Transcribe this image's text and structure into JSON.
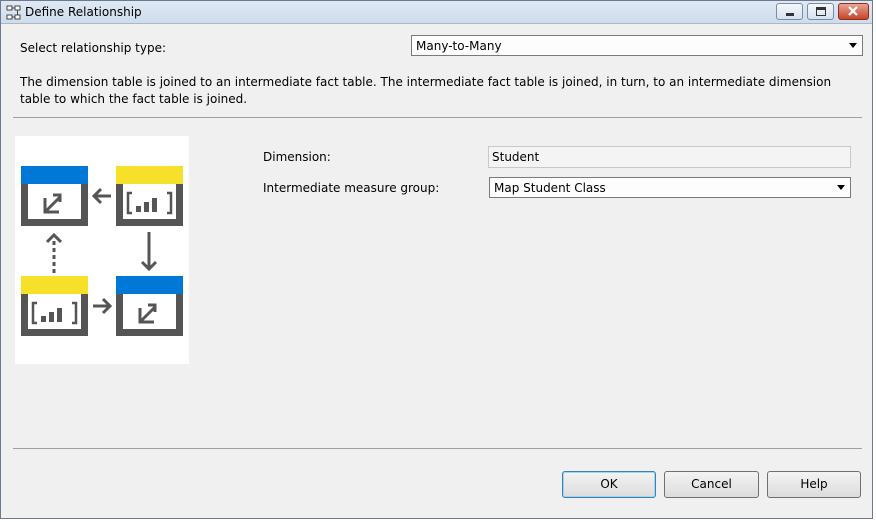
{
  "window": {
    "title": "Define Relationship"
  },
  "relationship": {
    "label": "Select relationship type:",
    "selected": "Many-to-Many",
    "description": "The dimension table is joined to an intermediate fact table. The intermediate fact table is joined, in turn, to an intermediate dimension table to which the fact table is joined."
  },
  "fields": {
    "dimension_label": "Dimension:",
    "dimension_value": "Student",
    "measure_group_label": "Intermediate measure group:",
    "measure_group_value": "Map Student Class"
  },
  "buttons": {
    "ok": "OK",
    "cancel": "Cancel",
    "help": "Help"
  },
  "colors": {
    "dimension_header": "#0078d7",
    "fact_header": "#f7e02a",
    "diagram_gray": "#555555"
  },
  "icons": {
    "title": "relationship-icon",
    "minimize": "minimize-icon",
    "maximize": "maximize-icon",
    "close": "close-icon"
  }
}
